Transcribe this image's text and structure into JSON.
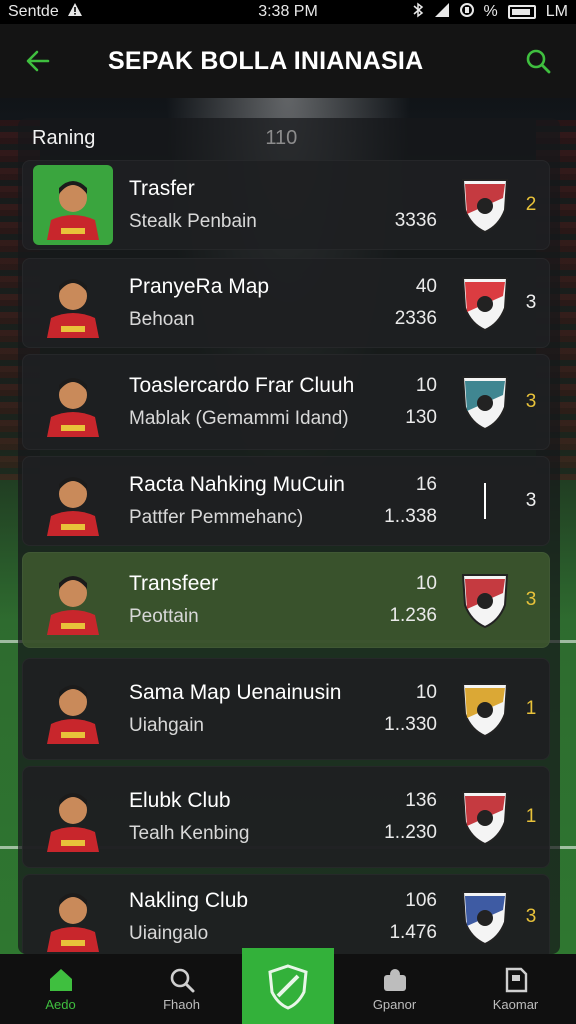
{
  "status_bar": {
    "carrier": "Sentde",
    "time": "3:38 PM",
    "percent": "%",
    "right_label": "LM"
  },
  "app_bar": {
    "title": "SEPAK BOLLA INIANASIA",
    "back_icon": "arrow-left-icon",
    "search_icon": "search-icon"
  },
  "list": {
    "header_label": "Raning",
    "header_count": "110",
    "rows": [
      {
        "name": "Trasfer",
        "sub": "Stealk Penbain",
        "top": "",
        "bottom": "3336",
        "rank": "2",
        "highlight": false,
        "avatar_green": true,
        "crest_color": "#c0262c"
      },
      {
        "name": "PranyeRa Map",
        "sub": "Behoan",
        "top": "40",
        "bottom": "2336",
        "rank": "3",
        "highlight": false,
        "avatar_green": false,
        "crest_color": "#d8282e"
      },
      {
        "name": "Toaslercardo Frar Cluuh",
        "sub": "Mablak  (Gemammi Idand)",
        "top": "10",
        "bottom": "130",
        "rank": "3",
        "highlight": false,
        "avatar_green": false,
        "crest_color": "#2c7a86"
      },
      {
        "name": "Racta Nahking MuCuin",
        "sub": "Pattfer Pemmehanc)",
        "top": "16",
        "bottom": "1..338",
        "rank": "3",
        "highlight": false,
        "avatar_green": false,
        "crest_color": "#ffffff"
      },
      {
        "name": "Transfeer",
        "sub": "Peottain",
        "top": "10",
        "bottom": "1.236",
        "rank": "3",
        "highlight": true,
        "avatar_green": false,
        "crest_color": "#c0262c"
      },
      {
        "name": "Sama Map Uenainusin",
        "sub": "Uiahgain",
        "top": "10",
        "bottom": "1..330",
        "rank": "1",
        "highlight": false,
        "avatar_green": false,
        "crest_color": "#d8a020"
      },
      {
        "name": "Elubk Club",
        "sub": "Tealh Kenbing",
        "top": "136",
        "bottom": "1..230",
        "rank": "1",
        "highlight": false,
        "avatar_green": false,
        "crest_color": "#c0262c"
      },
      {
        "name": "Nakling Club",
        "sub": "Uiaingalo",
        "top": "106",
        "bottom": "1.476",
        "rank": "3",
        "highlight": false,
        "avatar_green": false,
        "crest_color": "#2a4a9a"
      }
    ]
  },
  "bottom_nav": {
    "items": [
      {
        "label": "Aedo",
        "icon": "home-icon"
      },
      {
        "label": "Fhaoh",
        "icon": "search-icon"
      },
      {
        "label": "",
        "icon": "shield-icon"
      },
      {
        "label": "Gpanor",
        "icon": "person-icon"
      },
      {
        "label": "Kaomar",
        "icon": "document-icon"
      }
    ]
  },
  "colors": {
    "accent_green": "#3fbf3f",
    "rank_gold": "#e8c23a"
  }
}
